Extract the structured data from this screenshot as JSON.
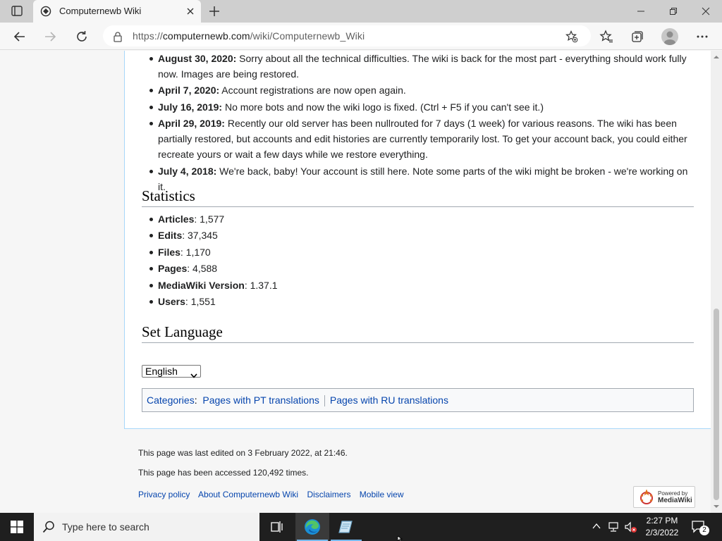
{
  "browser": {
    "tab_title": "Computernewb Wiki",
    "url_prefix": "https://",
    "url_host": "computernewb.com",
    "url_path": "/wiki/Computernewb_Wiki"
  },
  "news": [
    {
      "date": "August 30, 2020:",
      "text": " Sorry about all the technical difficulties. The wiki is back for the most part - everything should work fully",
      "text2": "now. Images are being restored."
    },
    {
      "date": "April 7, 2020:",
      "text": " Account registrations are now open again."
    },
    {
      "date": "July 16, 2019:",
      "text": " No more bots and now the wiki logo is fixed. (Ctrl + F5 if you can't see it.)"
    },
    {
      "date": "April 29, 2019:",
      "text": " Recently our old server has been nullrouted for 7 days (1 week) for various reasons. The wiki has been",
      "text2": "partially restored, but accounts and edit histories are currently temporarily lost. To get your account back, you could either",
      "text3": "recreate yours or wait a few days while we restore everything."
    },
    {
      "date": "July 4, 2018:",
      "text": " We're back, baby! Your account is still here. Note some parts of the wiki might be broken - we're working on",
      "text2": "it."
    }
  ],
  "statistics": {
    "heading": "Statistics",
    "items": [
      {
        "label": "Articles",
        "value": ": 1,577"
      },
      {
        "label": "Edits",
        "value": ": 37,345"
      },
      {
        "label": "Files",
        "value": ": 1,170"
      },
      {
        "label": "Pages",
        "value": ": 4,588"
      },
      {
        "label": "MediaWiki Version",
        "value": ": 1.37.1"
      },
      {
        "label": "Users",
        "value": ": 1,551"
      }
    ]
  },
  "language": {
    "heading": "Set Language",
    "selected": "English"
  },
  "categories": {
    "label": "Categories",
    "colon": ":",
    "items": [
      "Pages with PT translations",
      "Pages with RU translations"
    ]
  },
  "footer": {
    "last_edited": "This page was last edited on 3 February 2022, at 21:46.",
    "accessed": "This page has been accessed 120,492 times.",
    "links": [
      "Privacy policy",
      "About Computernewb Wiki",
      "Disclaimers",
      "Mobile view"
    ],
    "badge_line1": "Powered by",
    "badge_line2": "MediaWiki"
  },
  "taskbar": {
    "search_placeholder": "Type here to search",
    "time": "2:27 PM",
    "date": "2/3/2022",
    "notification_count": "2"
  }
}
